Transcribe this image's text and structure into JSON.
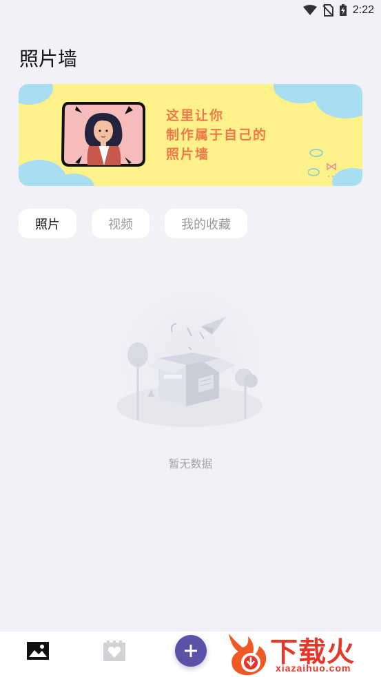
{
  "status_bar": {
    "time": "2:22"
  },
  "header": {
    "title": "照片墙"
  },
  "banner": {
    "line1": "这里让你",
    "line2": "制作属于自己的",
    "line3": "照片墙",
    "background_color": "#fdf28a",
    "text_color": "#f1784a"
  },
  "tabs": [
    {
      "label": "照片",
      "active": true
    },
    {
      "label": "视频",
      "active": false
    },
    {
      "label": "我的收藏",
      "active": false
    }
  ],
  "empty_state": {
    "text": "暂无数据"
  },
  "bottom_nav": {
    "items": [
      "image-icon",
      "heart-calendar-icon",
      "add-icon"
    ],
    "accent_color": "#5a52a6"
  },
  "watermark": {
    "brand": "下载火",
    "url": "xiazaihuo.com"
  }
}
